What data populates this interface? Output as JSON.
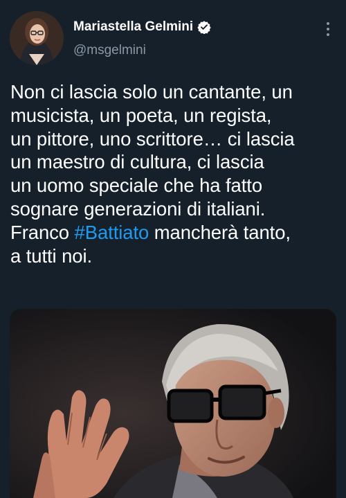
{
  "author": {
    "display_name": "Mariastella Gelmini",
    "handle": "@msgelmini",
    "verified": true
  },
  "tweet": {
    "lines": [
      {
        "text": "Non ci lascia solo un cantante, un"
      },
      {
        "text": "musicista, un poeta, un regista,"
      },
      {
        "text": "un pittore, uno scrittore… ci lascia"
      },
      {
        "text": "un maestro di cultura, ci lascia"
      },
      {
        "text": "un uomo speciale che ha fatto"
      },
      {
        "text": "sognare generazioni di italiani."
      },
      {
        "before": "Franco ",
        "hashtag": "#Battiato",
        "after": " mancherà tanto,"
      },
      {
        "text": "a tutti noi."
      }
    ]
  },
  "icons": {
    "verified": "verified-badge-icon",
    "more": "more-options-icon"
  },
  "colors": {
    "background": "#15202b",
    "text": "#ffffff",
    "secondary": "#8b98a5",
    "link": "#1d9bf0"
  }
}
